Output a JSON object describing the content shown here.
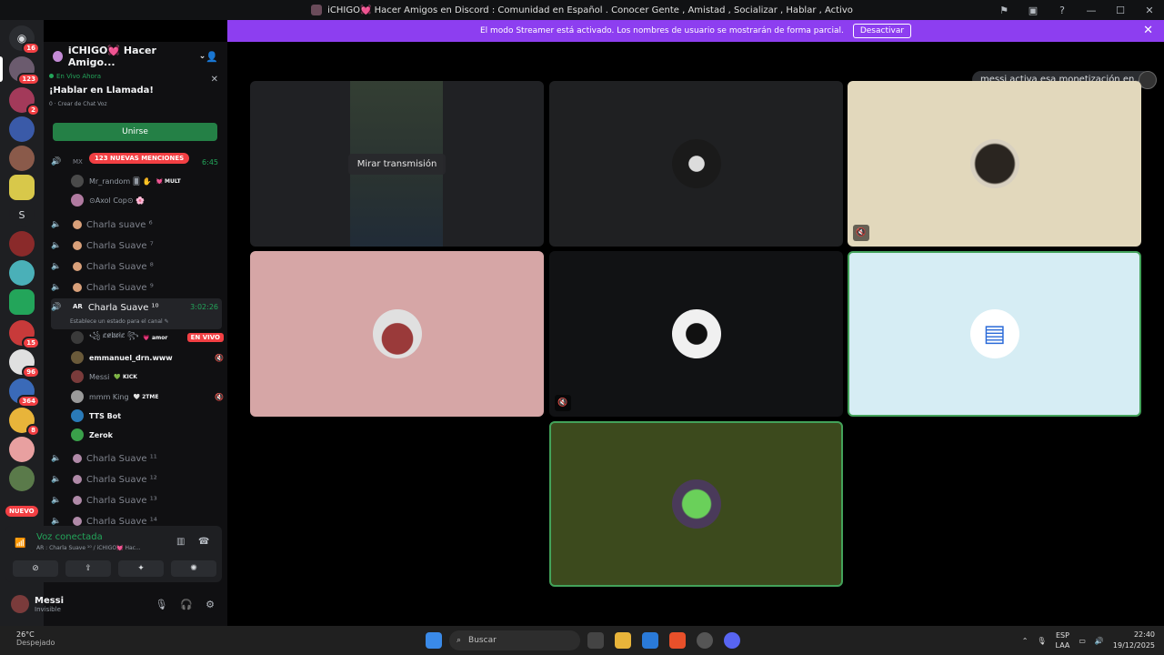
{
  "window": {
    "title": "iCHIGO💓 Hacer Amigos en Discord : Comunidad en Español . Conocer Gente , Amistad , Socializar , Hablar , Activo"
  },
  "banner": {
    "text": "El modo Streamer está activado. Los nombres de usuario se mostrarán de forma parcial.",
    "button": "Desactivar"
  },
  "rail": {
    "badges": [
      "16",
      "123",
      "2",
      "15",
      "96",
      "364",
      "8"
    ],
    "letter_server": "S",
    "new_label": "NUEVO"
  },
  "guild": {
    "name": "iCHIGO💓 Hacer Amigo..."
  },
  "live_card": {
    "label": "En Vivo Ahora",
    "title": "¡Hablar en Llamada!",
    "sub": "0  · Crear de Chat Voz",
    "join": "Unirse"
  },
  "mentions": "123 NUEVAS MENCIONES",
  "channels": {
    "top_time": "6:45",
    "top_label": "MX",
    "top_members": [
      {
        "name": "Mr_random 🂠 ✋",
        "tag": "💓 MULT"
      },
      {
        "name": "⊙Axol Cop⊙ 🌸",
        "tag": ""
      }
    ],
    "list_a": [
      "Charla suave ⁶",
      "Charla Suave ⁷",
      "Charla Suave ⁸",
      "Charla Suave ⁹"
    ],
    "active": {
      "prefix": "AR",
      "name": "Charla Suave ¹⁰",
      "time": "3:02:26",
      "status": "Establece un estado para el canal ✎"
    },
    "members": [
      {
        "name": "꧁ c̷e̷b̷r̷i̷c̷ ꧂",
        "tag": "💗 amor",
        "extra": "EN VIVO"
      },
      {
        "name": "emmanuel_drn.www",
        "tag": "",
        "extra": "mute"
      },
      {
        "name": "Messi",
        "tag": "💚 KICK",
        "extra": ""
      },
      {
        "name": "mmm King",
        "tag": "🤍 2TME",
        "extra": "mute"
      },
      {
        "name": "TTS Bot",
        "tag": "",
        "extra": ""
      },
      {
        "name": "Zerok",
        "tag": "",
        "extra": ""
      }
    ],
    "list_b": [
      "Charla Suave ¹¹",
      "Charla Suave ¹²",
      "Charla Suave ¹³",
      "Charla Suave ¹⁴"
    ]
  },
  "voice": {
    "status": "Voz conectada",
    "channel": "AR : Charla Suave ¹⁰ / iCHIGO💓 Hac..."
  },
  "user": {
    "name": "Messi",
    "status": "Invisible"
  },
  "stage": {
    "watch_stream": "Mirar transmisión",
    "toast": "messi activa esa monetización en..."
  },
  "taskbar": {
    "temp": "26°C",
    "condition": "Despejado",
    "search": "Buscar",
    "lang": "ESP",
    "lang2": "LAA",
    "time": "22:40",
    "date": "19/12/2025"
  },
  "colors": {
    "banner": "#8d3ef0",
    "join": "#248046",
    "tile_beige": "#e2d8bc",
    "tile_pink": "#d6a6a6",
    "tile_lightblue": "#d6edf4",
    "tile_olive": "#3c4a1d",
    "speaking_border": "#43a25a"
  }
}
